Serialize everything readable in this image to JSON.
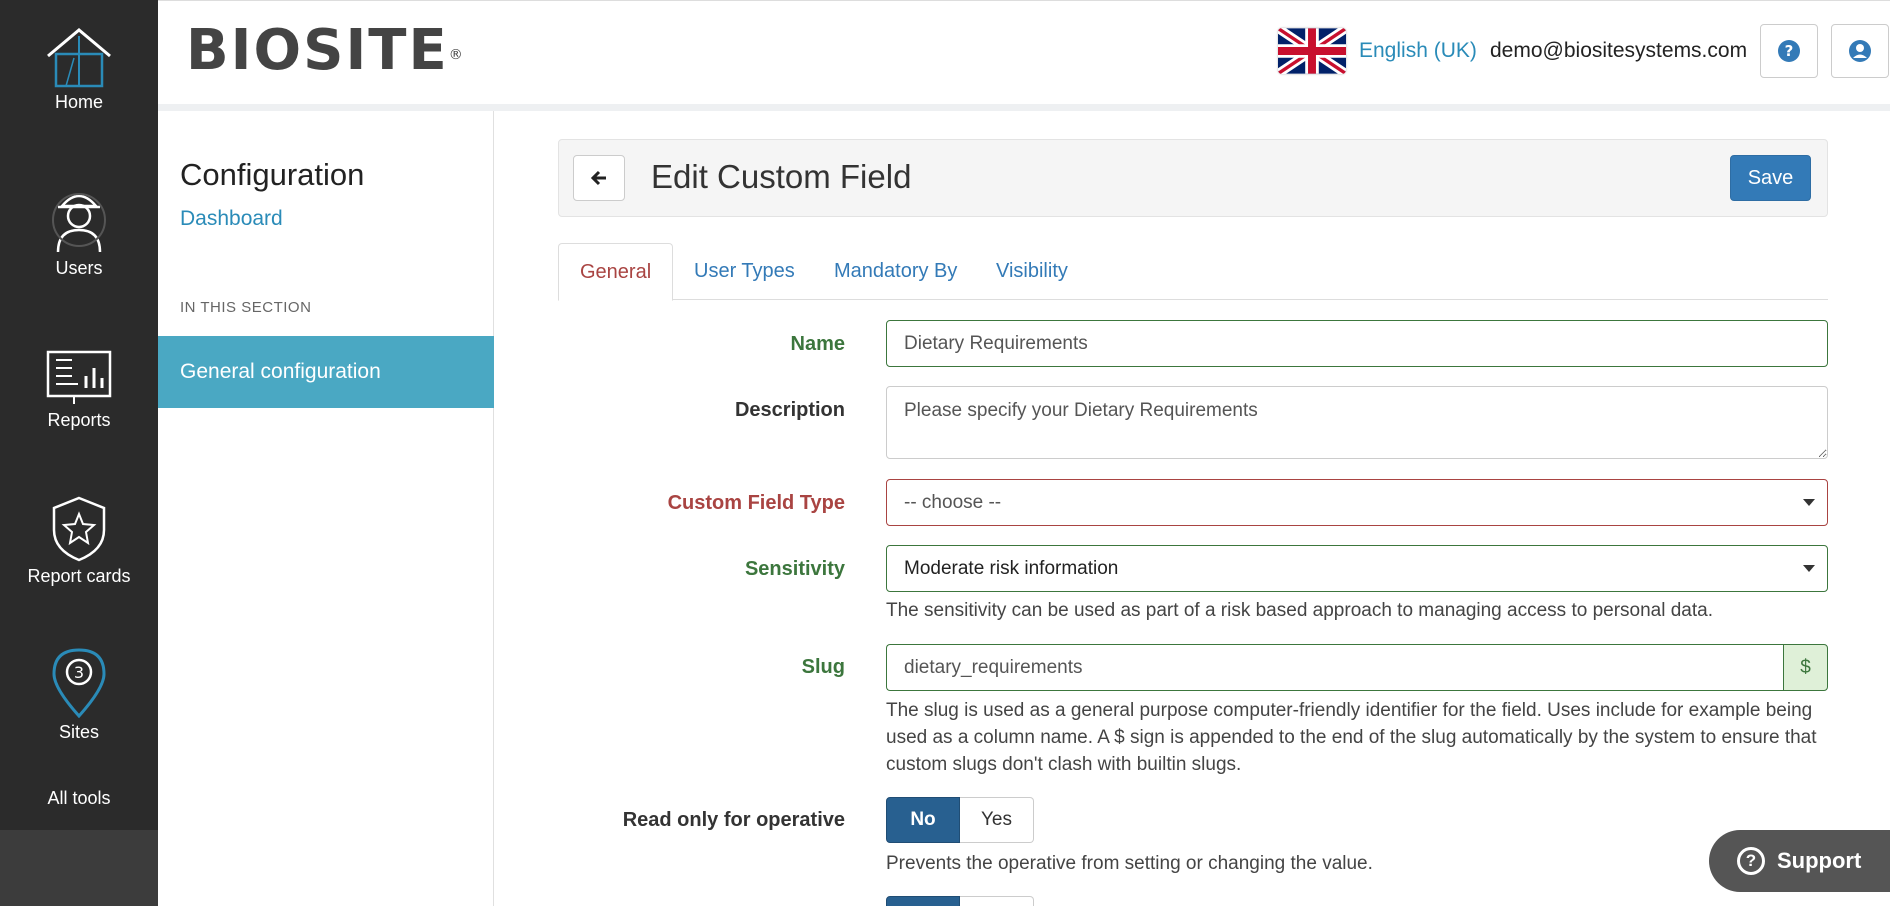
{
  "rail": {
    "items": [
      {
        "label": "Home",
        "icon": "house-icon"
      },
      {
        "label": "Users",
        "icon": "worker-icon"
      },
      {
        "label": "Reports",
        "icon": "reports-icon"
      },
      {
        "label": "Report cards",
        "icon": "shield-star-icon"
      },
      {
        "label": "Sites",
        "icon": "map-pin-icon"
      }
    ],
    "all_tools": "All tools"
  },
  "header": {
    "logo": "BIOSITE",
    "logo_mark": "®",
    "language": "English (UK)",
    "email": "demo@biositesystems.com"
  },
  "sidebar": {
    "title": "Configuration",
    "dashboard_link": "Dashboard",
    "section_heading": "IN THIS SECTION",
    "active_item": "General configuration"
  },
  "main": {
    "title": "Edit Custom Field",
    "save_label": "Save",
    "tabs": [
      {
        "label": "General",
        "active": true
      },
      {
        "label": "User Types",
        "active": false
      },
      {
        "label": "Mandatory By",
        "active": false
      },
      {
        "label": "Visibility",
        "active": false
      }
    ],
    "form": {
      "name_label": "Name",
      "name_value": "Dietary Requirements",
      "description_label": "Description",
      "description_value": "Please specify your Dietary Requirements",
      "type_label": "Custom Field Type",
      "type_value": "-- choose --",
      "sensitivity_label": "Sensitivity",
      "sensitivity_value": "Moderate risk information",
      "sensitivity_help": "The sensitivity can be used as part of a risk based approach to managing access to personal data.",
      "slug_label": "Slug",
      "slug_value": "dietary_requirements",
      "slug_addon": "$",
      "slug_help": "The slug is used as a general purpose computer-friendly identifier for the field. Uses include for example being used as a column name. A $ sign is appended to the end of the slug automatically by the system to ensure that custom slugs don't clash with builtin slugs.",
      "readonly_label": "Read only for operative",
      "readonly_no": "No",
      "readonly_yes": "Yes",
      "readonly_help": "Prevents the operative from setting or changing the value."
    }
  },
  "support_label": "Support",
  "colors": {
    "rail": "#2b2b2b",
    "accent": "#4aa8c3",
    "primary": "#337ab7",
    "success": "#3c763d",
    "danger": "#a94442"
  }
}
